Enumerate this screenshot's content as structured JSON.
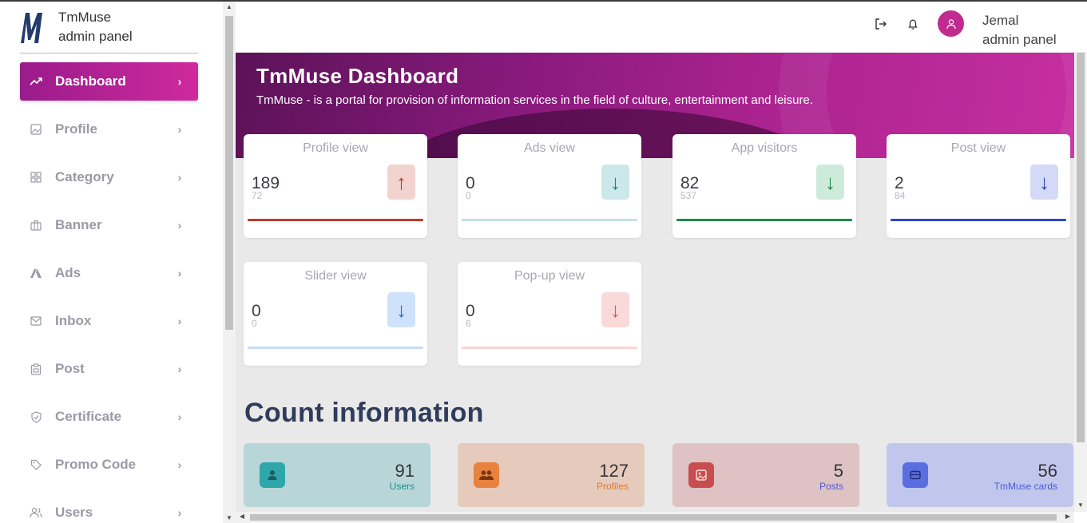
{
  "brand": {
    "name_line1": "TmMuse",
    "name_line2": "admin panel"
  },
  "sidebar": {
    "items": [
      {
        "label": "Dashboard",
        "icon": "trending-up-icon",
        "active": true
      },
      {
        "label": "Profile",
        "icon": "image-icon"
      },
      {
        "label": "Category",
        "icon": "grid-icon"
      },
      {
        "label": "Banner",
        "icon": "briefcase-icon"
      },
      {
        "label": "Ads",
        "icon": "ads-icon"
      },
      {
        "label": "Inbox",
        "icon": "mail-icon"
      },
      {
        "label": "Post",
        "icon": "clipboard-icon"
      },
      {
        "label": "Certificate",
        "icon": "shield-icon"
      },
      {
        "label": "Promo Code",
        "icon": "tag-icon"
      },
      {
        "label": "Users",
        "icon": "users-icon"
      }
    ]
  },
  "header": {
    "user_name": "Jemal",
    "user_role": "admin panel"
  },
  "dashboard": {
    "title": "TmMuse Dashboard",
    "subtitle": "TmMuse - is a portal for provision of information services in the field of culture, entertainment and leisure."
  },
  "stats": [
    {
      "title": "Profile view",
      "value": "189",
      "sub": "72",
      "arrow": "↑",
      "trend": "up",
      "color": "#c0392b",
      "badge_bg": "#f3d3cf"
    },
    {
      "title": "Ads view",
      "value": "0",
      "sub": "0",
      "arrow": "↓",
      "trend": "down",
      "color": "#17808a",
      "badge_bg": "#cde8ea"
    },
    {
      "title": "App visitors",
      "value": "82",
      "sub": "537",
      "arrow": "↓",
      "trend": "down",
      "color": "#1e8a48",
      "badge_bg": "#cdeada"
    },
    {
      "title": "Post view",
      "value": "2",
      "sub": "84",
      "arrow": "↓",
      "trend": "down",
      "color": "#2f46c4",
      "badge_bg": "#d3d9f6"
    },
    {
      "title": "Slider view",
      "value": "0",
      "sub": "0",
      "arrow": "↓",
      "trend": "down",
      "color": "#1a6fe0",
      "badge_bg": "#cfe2fb"
    },
    {
      "title": "Pop-up view",
      "value": "0",
      "sub": "6",
      "arrow": "↓",
      "trend": "down",
      "color": "#e05555",
      "badge_bg": "#fbd9d9"
    }
  ],
  "count_section": {
    "title": "Count information"
  },
  "counts": [
    {
      "value": "91",
      "label": "Users",
      "icon": "user-icon",
      "bg": "#b8d6d7",
      "icon_bg": "#2fa6aa",
      "label_color": "#1f8d8f"
    },
    {
      "value": "127",
      "label": "Profiles",
      "icon": "group-icon",
      "bg": "#e6cbbd",
      "icon_bg": "#e8823e",
      "label_color": "#e0782f"
    },
    {
      "value": "5",
      "label": "Posts",
      "icon": "image-post-icon",
      "bg": "#dfc2c3",
      "icon_bg": "#c64e4e",
      "label_color": "#4a5ad8"
    },
    {
      "value": "56",
      "label": "TmMuse cards",
      "icon": "card-icon",
      "bg": "#c1c7ec",
      "icon_bg": "#5b6ee0",
      "label_color": "#4a5ad8"
    }
  ]
}
